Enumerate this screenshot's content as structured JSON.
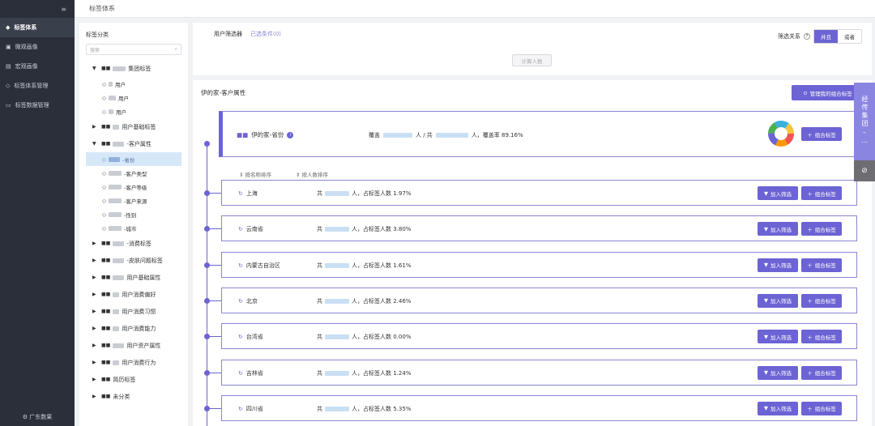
{
  "sidebar": {
    "collapse_icon": "≡",
    "items": [
      {
        "label": "标签体系",
        "icon": "tag-icon",
        "active": true
      },
      {
        "label": "微观画像",
        "icon": "image-icon"
      },
      {
        "label": "宏观画像",
        "icon": "chart-icon"
      },
      {
        "label": "标签体系管理",
        "icon": "tag-manage-icon"
      },
      {
        "label": "标签数据管理",
        "icon": "data-icon"
      }
    ],
    "footer": "广东数果"
  },
  "topbar": {
    "title": "标签体系"
  },
  "tree": {
    "title": "标签分类",
    "search_placeholder": "搜索",
    "groups": [
      {
        "label": "集团标签",
        "expanded": true,
        "children": [
          "用户",
          "用户",
          "用户"
        ]
      },
      {
        "label": "用户基础标签",
        "expanded": false
      },
      {
        "label": "-客户属性",
        "expanded": true,
        "children": [
          "-省份",
          "-客户类型",
          "-客户等级",
          "-客户来源",
          "-性别",
          "-城市"
        ]
      },
      {
        "label": "-消费标签",
        "expanded": false
      },
      {
        "label": "-皮肤问题标签",
        "expanded": false
      },
      {
        "label": "用户基础属性",
        "expanded": false
      },
      {
        "label": "用户消费偏好",
        "expanded": false
      },
      {
        "label": "用户消费习惯",
        "expanded": false
      },
      {
        "label": "用户消费能力",
        "expanded": false
      },
      {
        "label": "用户资产属性",
        "expanded": false
      },
      {
        "label": "用户消费行为",
        "expanded": false
      },
      {
        "label": "简历标签",
        "expanded": false
      },
      {
        "label": "未分类",
        "expanded": false
      }
    ]
  },
  "filter": {
    "title": "用户筛选器",
    "conditions": "已选条件(0)",
    "relation_label": "筛选关系",
    "and_label": "并且",
    "or_label": "或者",
    "calc_button": "计算人数"
  },
  "main": {
    "header": "伊的家-客户属性",
    "manage_button": "管理我的组合标签",
    "summary": {
      "title": "伊的家-省份",
      "cover_prefix": "覆盖",
      "cover_mid": "人 / 共",
      "cover_suffix": "人，覆盖率 89.16%",
      "combine_button": "组合标签"
    },
    "sort_by_name": "按名称排序",
    "sort_by_count": "按人数排序",
    "rows": [
      {
        "name": "上海",
        "pct": "人，占标签人数 1.97%"
      },
      {
        "name": "云南省",
        "pct": "人，占标签人数 3.80%"
      },
      {
        "name": "内蒙古自治区",
        "pct": "人，占标签人数 1.61%"
      },
      {
        "name": "北京",
        "pct": "人，占标签人数 2.46%"
      },
      {
        "name": "台湾省",
        "pct": "人，占标签人数 0.00%"
      },
      {
        "name": "吉林省",
        "pct": "人，占标签人数 1.24%"
      },
      {
        "name": "四川省",
        "pct": "人，占标签人数 5.35%"
      }
    ],
    "row_prefix": "共",
    "add_filter": "加入筛选",
    "combine": "组合标签"
  },
  "side_tab": {
    "text": "经传集团"
  }
}
